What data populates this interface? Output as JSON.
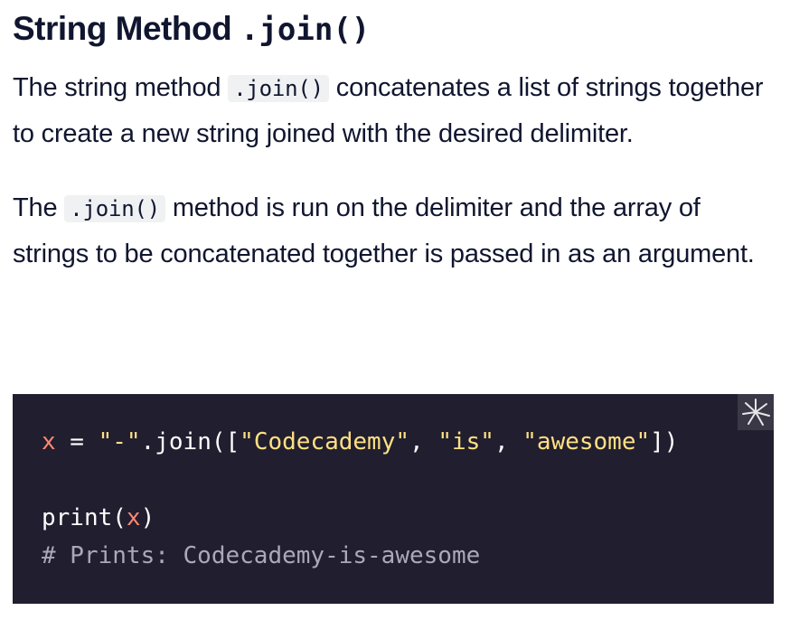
{
  "heading": {
    "text": "String Method ",
    "code": ".join()"
  },
  "paragraph1": {
    "before": "The string method ",
    "code": ".join()",
    "after": " concatenates a list of strings together to create a new string joined with the desired delimiter."
  },
  "paragraph2": {
    "before": "The ",
    "code": ".join()",
    "after": " method is run on the delimiter and the array of strings to be concatenated together is passed in as an argument."
  },
  "code": {
    "line1": {
      "var": "x",
      "assign": " = ",
      "delim": "\"-\"",
      "call": ".join([",
      "s1": "\"Codecademy\"",
      "sep1": ", ",
      "s2": "\"is\"",
      "sep2": ", ",
      "s3": "\"awesome\"",
      "close": "])"
    },
    "line3": {
      "fn": "print(",
      "arg": "x",
      "close": ")"
    },
    "comment": "# Prints: Codecademy-is-awesome"
  },
  "icons": {
    "corner": "sparkle-icon"
  }
}
